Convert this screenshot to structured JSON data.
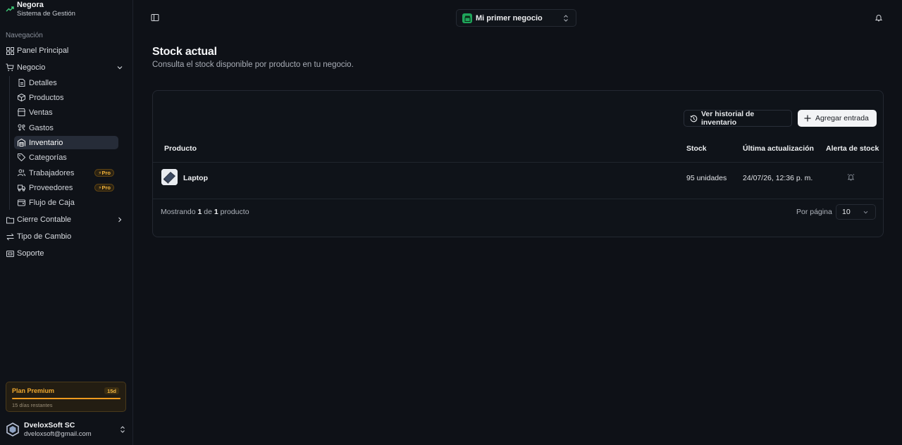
{
  "brand": {
    "name": "Negora",
    "subtitle": "Sistema de Gestión"
  },
  "sidebar": {
    "heading": "Navegación",
    "items": [
      {
        "label": "Panel Principal",
        "icon": "grid-icon"
      },
      {
        "label": "Negocio",
        "icon": "cart-icon",
        "expanded": true
      },
      {
        "label": "Cierre Contable",
        "icon": "folder-icon"
      },
      {
        "label": "Tipo de Cambio",
        "icon": "exchange-icon"
      },
      {
        "label": "Soporte",
        "icon": "support-icon"
      }
    ],
    "sub_items": [
      {
        "label": "Detalles",
        "icon": "document-icon"
      },
      {
        "label": "Productos",
        "icon": "package-icon"
      },
      {
        "label": "Ventas",
        "icon": "storefront-icon"
      },
      {
        "label": "Gastos",
        "icon": "wallet-icon"
      },
      {
        "label": "Inventario",
        "icon": "warehouse-icon",
        "active": true
      },
      {
        "label": "Categorías",
        "icon": "tag-icon"
      },
      {
        "label": "Trabajadores",
        "icon": "users-icon",
        "badge": "Pro"
      },
      {
        "label": "Proveedores",
        "icon": "truck-icon",
        "badge": "Pro"
      },
      {
        "label": "Flujo de Caja",
        "icon": "cash-icon"
      }
    ]
  },
  "plan": {
    "title": "Plan Premium",
    "days_badge": "15d",
    "remaining": "15 días restantes",
    "progress": 1.0,
    "accent": "#ef9b1f"
  },
  "user": {
    "name": "DveloxSoft SC",
    "email": "dveloxsoft@gmail.com"
  },
  "topbar": {
    "business": "Mi primer negocio"
  },
  "page": {
    "title": "Stock actual",
    "subtitle": "Consulta el stock disponible por producto en tu negocio."
  },
  "actions": {
    "history": "Ver historial de inventario",
    "add": "Agregar entrada"
  },
  "table": {
    "columns": [
      "Producto",
      "Stock",
      "Última actualización",
      "Alerta de stock"
    ],
    "rows": [
      {
        "product": "Laptop",
        "stock": "95 unidades",
        "updated": "24/07/26, 12:36 p. m."
      }
    ]
  },
  "footer": {
    "showing_prefix": "Mostrando",
    "showing_from": "1",
    "showing_of": "de",
    "showing_total": "1",
    "showing_suffix": "producto",
    "per_page_label": "Por página",
    "per_page_value": "10"
  }
}
